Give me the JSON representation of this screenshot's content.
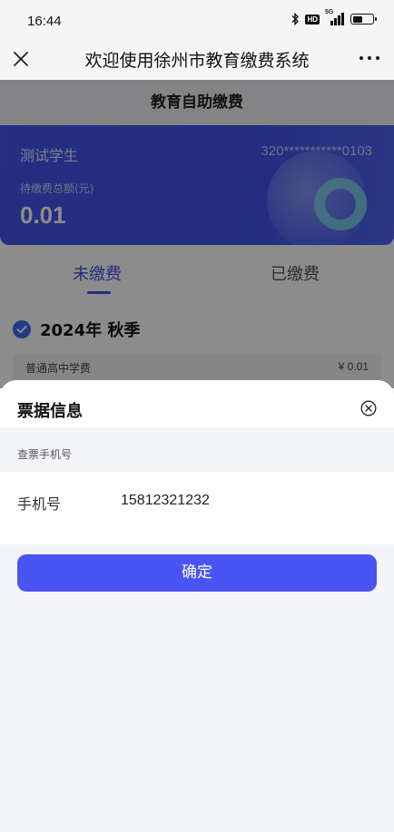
{
  "status_bar": {
    "time": "16:44",
    "network": "5G",
    "hd_badge": "HD",
    "battery_level": 0.5
  },
  "nav": {
    "title": "欢迎使用徐州市教育缴费系统",
    "close_icon": "close-icon",
    "more_icon": "more-icon"
  },
  "page": {
    "header_title": "教育自助缴费",
    "student_name": "测试学生",
    "student_id": "320***********0103",
    "due_label": "待缴费总额(元)",
    "due_amount": "0.01",
    "tabs": [
      {
        "label": "未缴费",
        "active": true
      },
      {
        "label": "已缴费",
        "active": false
      }
    ],
    "term_label": "2024年 秋季",
    "fee_items": [
      {
        "name": "普通高中学费",
        "amount": "¥ 0.01"
      }
    ]
  },
  "sheet": {
    "title": "票据信息",
    "section_label": "查票手机号",
    "phone_label": "手机号",
    "phone_value": "15812321232",
    "confirm_label": "确定"
  },
  "colors": {
    "accent": "#4a54f4",
    "card": "#4457ee",
    "tab_active": "#3f52e8"
  }
}
